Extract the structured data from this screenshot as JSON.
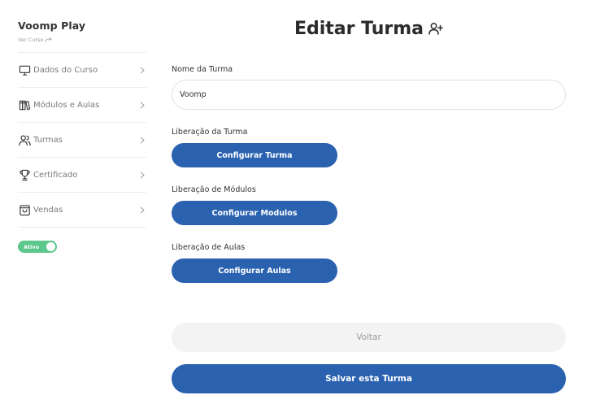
{
  "sidebar": {
    "brand": "Voomp Play",
    "ver_curso": "Ver Curso",
    "items": [
      {
        "label": "Dados do Curso",
        "icon": "monitor-icon"
      },
      {
        "label": "Módulos e Aulas",
        "icon": "book-icon"
      },
      {
        "label": "Turmas",
        "icon": "users-icon"
      },
      {
        "label": "Certificado",
        "icon": "trophy-icon"
      },
      {
        "label": "Vendas",
        "icon": "shopping-bag-icon"
      }
    ],
    "toggle_label": "Ativo",
    "toggle_on": true
  },
  "main": {
    "title": "Editar Turma",
    "name_label": "Nome da Turma",
    "name_value": "Voomp",
    "sections": [
      {
        "label": "Liberação da Turma",
        "button": "Configurar Turma"
      },
      {
        "label": "Liberação de Módulos",
        "button": "Configurar Modulos"
      },
      {
        "label": "Liberação de Aulas",
        "button": "Configurar Aulas"
      }
    ],
    "back_label": "Voltar",
    "save_label": "Salvar esta Turma"
  },
  "colors": {
    "primary": "#2a62b0",
    "toggle_on": "#5cc88c",
    "secondary_bg": "#f3f3f3"
  }
}
